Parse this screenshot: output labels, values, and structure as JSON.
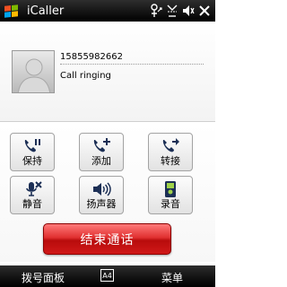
{
  "titlebar": {
    "app_title": "iCaller",
    "icons": [
      "windows-logo-icon",
      "network-icon",
      "missed-call-icon",
      "volume-icon",
      "close-icon"
    ]
  },
  "caller": {
    "phone_number": "15855982662",
    "status": "Call ringing"
  },
  "controls": {
    "hold": "保持",
    "add": "添加",
    "transfer": "转接",
    "mute": "静音",
    "speaker": "扬声器",
    "record": "录音"
  },
  "end_call_label": "结束通话",
  "menubar": {
    "left_softkey": "拨号面板",
    "keyboard_label": "A4",
    "right_softkey": "菜单"
  },
  "colors": {
    "end_call": "#d01818",
    "title_bar": "#141414"
  }
}
